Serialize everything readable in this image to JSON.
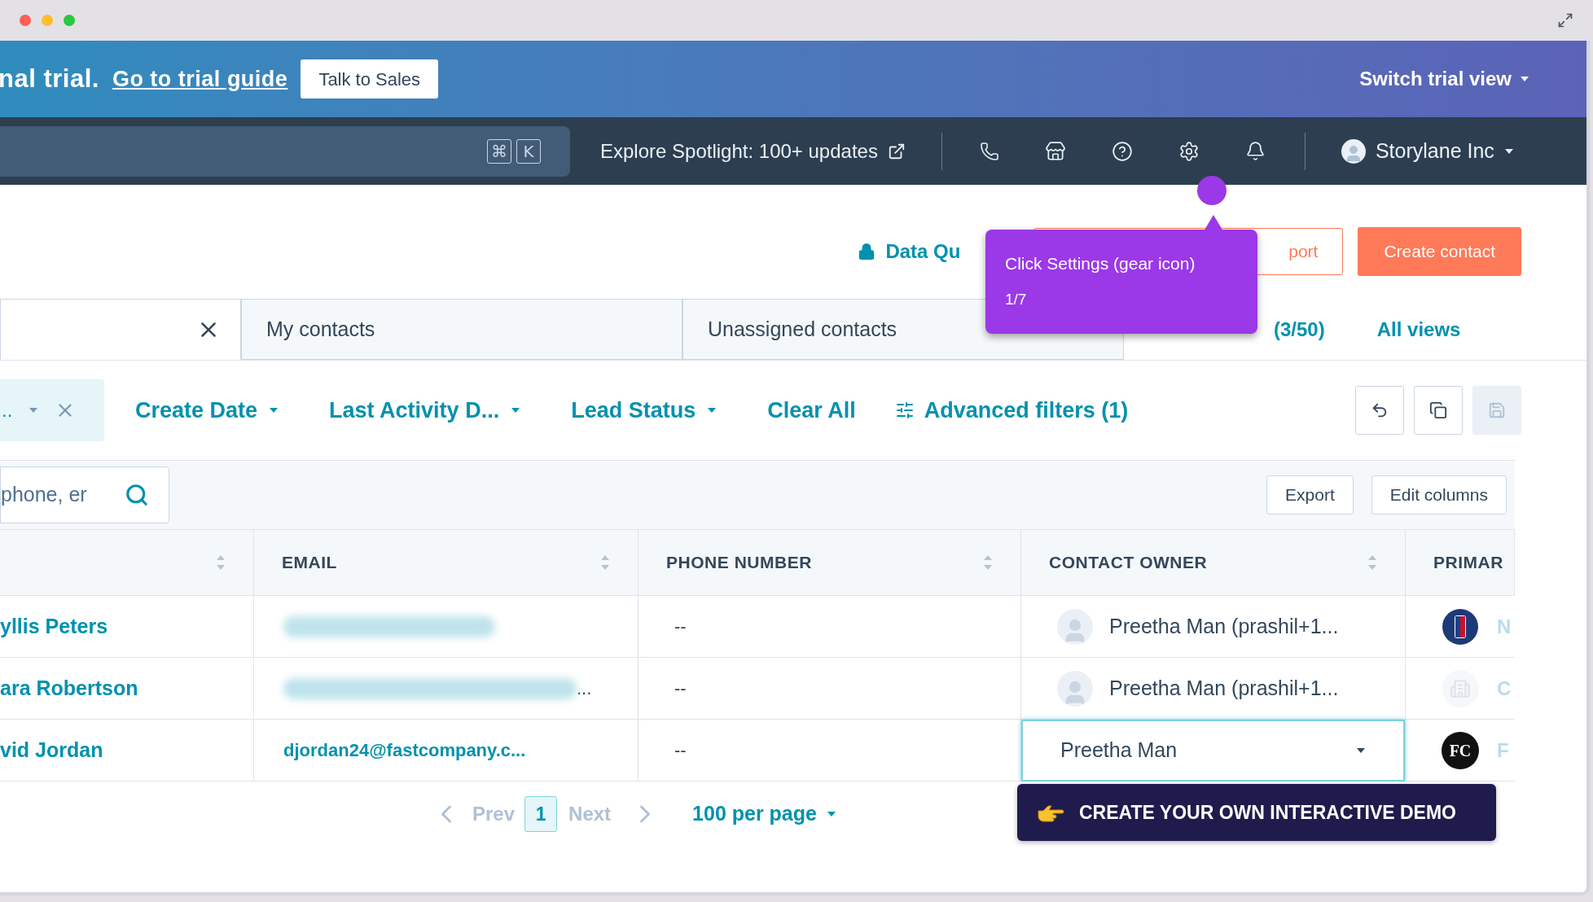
{
  "trial_banner": {
    "text": "nal trial.",
    "link": "Go to trial guide",
    "button": "Talk to Sales",
    "switch": "Switch trial view"
  },
  "nav": {
    "shortcut_keys": [
      "⌘",
      "K"
    ],
    "spotlight": "Explore Spotlight: 100+ updates",
    "account": "Storylane Inc"
  },
  "header": {
    "data_quality": "Data Qu",
    "import": "port",
    "create": "Create contact"
  },
  "view_tabs": [
    {
      "selected": true,
      "closable": true
    },
    {
      "label": "My contacts",
      "selected": false
    },
    {
      "label": "Unassigned contacts",
      "selected": false
    }
  ],
  "add_view": "(3/50)",
  "all_views": "All views",
  "filters": {
    "chip": "..",
    "items": [
      {
        "label": "Create Date",
        "kind": "dropdown"
      },
      {
        "label": "Last Activity D...",
        "kind": "dropdown"
      },
      {
        "label": "Lead Status",
        "kind": "dropdown"
      },
      {
        "label": "Clear All",
        "kind": "link"
      },
      {
        "label": "Advanced filters (1)",
        "kind": "advanced"
      }
    ]
  },
  "toolbar_buttons": [
    {
      "kind": "undo",
      "disabled": false
    },
    {
      "kind": "copy",
      "disabled": false
    },
    {
      "kind": "save",
      "disabled": true
    }
  ],
  "search": {
    "placeholder": "phone, er"
  },
  "table_actions": [
    "Export",
    "Edit columns"
  ],
  "table": {
    "columns": [
      {
        "sortable": true
      },
      {
        "label": "EMAIL",
        "sortable": true
      },
      {
        "label": "PHONE NUMBER",
        "sortable": true
      },
      {
        "label": "CONTACT OWNER",
        "sortable": true
      },
      {
        "label": "PRIMAR",
        "sortable": false
      }
    ],
    "rows": [
      {
        "name": "yllis Peters",
        "email": {
          "redacted": true
        },
        "phone": "--",
        "owner": {
          "kind": "text",
          "label": "Preetha Man (prashil+1..."
        },
        "company": {
          "kind": "badge",
          "initial": "N"
        }
      },
      {
        "name": "ara Robertson",
        "email": {
          "redacted": true,
          "tail": "..."
        },
        "phone": "--",
        "owner": {
          "kind": "text",
          "label": "Preetha Man (prashil+1..."
        },
        "company": {
          "kind": "building",
          "initial": "C"
        }
      },
      {
        "name": "vid Jordan",
        "email": {
          "redacted": false,
          "text": "djordan24@fastcompany.c..."
        },
        "phone": "--",
        "owner": {
          "kind": "select",
          "label": "Preetha Man"
        },
        "company": {
          "kind": "monogram",
          "logo_text": "FC",
          "initial": "F"
        }
      }
    ]
  },
  "pagination": {
    "prev": "Prev",
    "page": "1",
    "next": "Next",
    "per_page": "100 per page",
    "prev_disabled": true,
    "next_disabled": true
  },
  "tooltip": {
    "text": "Click Settings (gear icon)",
    "step": "1/7"
  },
  "demo_banner": {
    "text": "CREATE YOUR OWN INTERACTIVE DEMO"
  }
}
